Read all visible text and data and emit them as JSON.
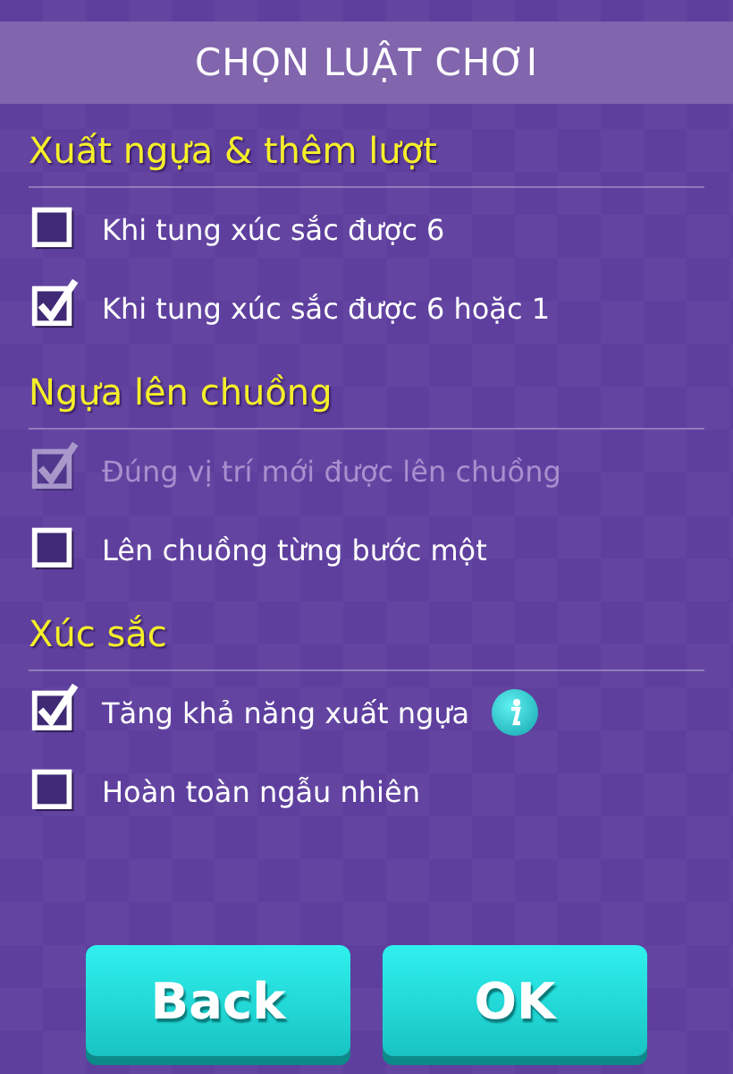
{
  "title": "CHỌN LUẬT CHƠI",
  "sections": [
    {
      "heading": "Xuất ngựa & thêm lượt",
      "options": [
        {
          "label": "Khi tung xúc sắc được 6",
          "checked": false,
          "disabled": false,
          "info": false
        },
        {
          "label": "Khi tung xúc sắc được 6 hoặc 1",
          "checked": true,
          "disabled": false,
          "info": false
        }
      ]
    },
    {
      "heading": "Ngựa lên chuồng",
      "options": [
        {
          "label": "Đúng vị trí mới được lên chuồng",
          "checked": true,
          "disabled": true,
          "info": false
        },
        {
          "label": "Lên chuồng từng bước một",
          "checked": false,
          "disabled": false,
          "info": false
        }
      ]
    },
    {
      "heading": "Xúc sắc",
      "options": [
        {
          "label": "Tăng khả năng xuất ngựa",
          "checked": true,
          "disabled": false,
          "info": true
        },
        {
          "label": "Hoàn toàn ngẫu nhiên",
          "checked": false,
          "disabled": false,
          "info": false
        }
      ]
    }
  ],
  "buttons": [
    "Back",
    "OK"
  ]
}
